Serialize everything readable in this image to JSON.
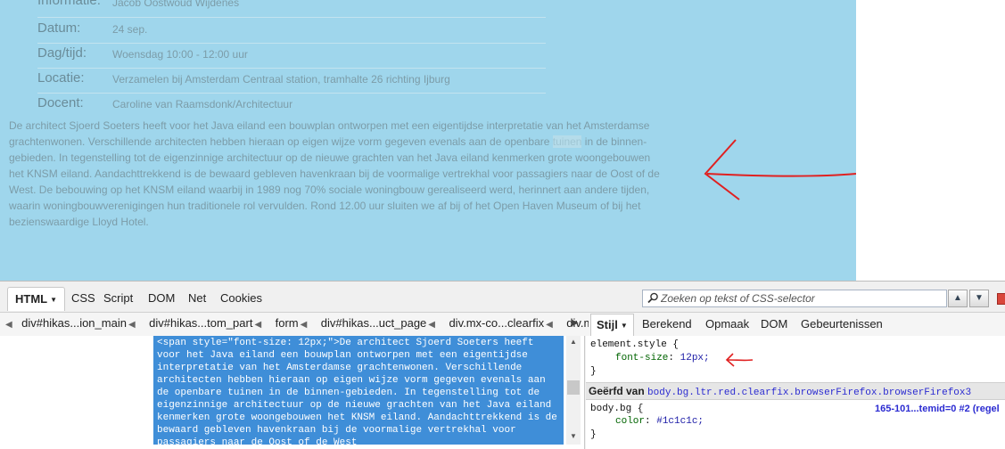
{
  "page": {
    "info_rows": [
      {
        "label": "Informatie:",
        "value": "Jacob Oostwoud Wijdenes"
      },
      {
        "label": "Datum:",
        "value": "24 sep."
      },
      {
        "label": "Dag/tijd:",
        "value": "Woensdag 10:00 - 12:00 uur"
      },
      {
        "label": "Locatie:",
        "value": "Verzamelen bij Amsterdam Centraal station, tramhalte 26 richting Ijburg"
      },
      {
        "label": "Docent:",
        "value": "Caroline van Raamsdonk/Architectuur"
      }
    ],
    "description": {
      "before": "De architect Sjoerd Soeters heeft voor het Java eiland een bouwplan ontworpen met een eigentijdse interpretatie van het Amsterdamse grachtenwonen. Verschillende architecten hebben hieraan op eigen wijze vorm gegeven evenals aan de openbare ",
      "selected": "tuinen",
      "after": " in de binnen-gebieden. In tegenstelling tot de eigenzinnige architectuur op de nieuwe grachten van het Java eiland kenmerken grote woongebouwen het KNSM eiland. Aandachttrekkend is de bewaard gebleven havenkraan bij de voormalige vertrekhal voor passagiers naar de Oost of de West. De bebouwing op het KNSM eiland waarbij in 1989 nog 70% sociale woningbouw gerealiseerd werd, herinnert aan andere tijden, waarin woningbouwverenigingen hun traditionele rol vervulden. Rond 12.00 uur sluiten we af bij of het Open Haven Museum of bij het bezienswaardige Lloyd Hotel."
    }
  },
  "firebug": {
    "tabs": [
      "HTML",
      "CSS",
      "Script",
      "DOM",
      "Net",
      "Cookies"
    ],
    "search_placeholder": "Zoeken op tekst of CSS-selector",
    "breadcrumbs": [
      "div#hikas...ion_main",
      "div#hikas...tom_part",
      "form",
      "div#hikas...uct_page",
      "div.mx-co...clearfix",
      "div.mx-i"
    ],
    "side_tabs": [
      "Stijl",
      "Berekend",
      "Opmaak",
      "DOM",
      "Gebeurtenissen"
    ],
    "html_code": "<span style=\"font-size: 12px;\">De architect Sjoerd Soeters heeft voor het Java eiland een bouwplan ontworpen met een eigentijdse interpretatie van het Amsterdamse grachtenwonen. Verschillende architecten hebben hieraan op eigen wijze vorm gegeven evenals aan de openbare tuinen in de binnen-gebieden. In tegenstelling tot de eigenzinnige architectuur op de nieuwe grachten van het Java eiland kenmerken grote woongebouwen het KNSM eiland. Aandachttrekkend is de bewaard gebleven havenkraan bij de voormalige vertrekhal voor passagiers naar de Oost of de West",
    "style": {
      "element_selector": "element.style {",
      "font_prop": "font-size",
      "font_val": "12px;",
      "close_brace": "}",
      "inherit_label": "Geërfd van",
      "inherit_selector": "body.bg.ltr.red.clearfix.browserFirefox.browserFirefox3",
      "body_selector": "body.bg {",
      "color_prop": "color",
      "color_val": "#1c1c1c;",
      "source_link": "165-101...temid=0 #2 (regel"
    }
  },
  "colors": {
    "page_highlight": "#9fd6ec",
    "selection": "#3f8ed8",
    "annotation": "#e02020"
  }
}
